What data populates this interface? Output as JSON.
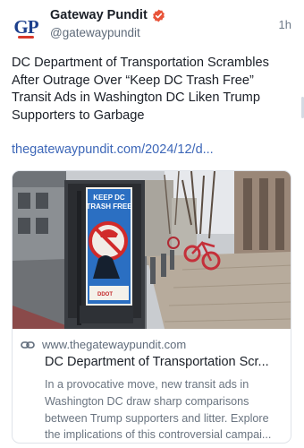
{
  "author": {
    "avatar_text": "GP",
    "name": "Gateway Pundit",
    "handle": "@gatewaypundit",
    "verified_icon": "verified-badge-icon",
    "verified_color": "#e8543a"
  },
  "post": {
    "time": "1h",
    "text": "DC Department of Transportation Scrambles After Outrage Over “Keep DC Trash Free” Transit Ads in Washington DC Liken Trump Supporters to Garbage",
    "link_text": "thegatewaypundit.com/2024/12/d...",
    "link_color": "#3d67b8"
  },
  "card": {
    "image_sign_line1": "KEEP DC",
    "image_sign_line2": "TRASH FREE",
    "image_brand": "DDOT",
    "link_icon": "link-icon",
    "domain": "www.thegatewaypundit.com",
    "title": "DC Department of Transportation Scr...",
    "description": "In a provocative move, new transit ads in Washington DC draw sharp comparisons between Trump supporters and litter. Explore the implications of this controversial campai..."
  }
}
